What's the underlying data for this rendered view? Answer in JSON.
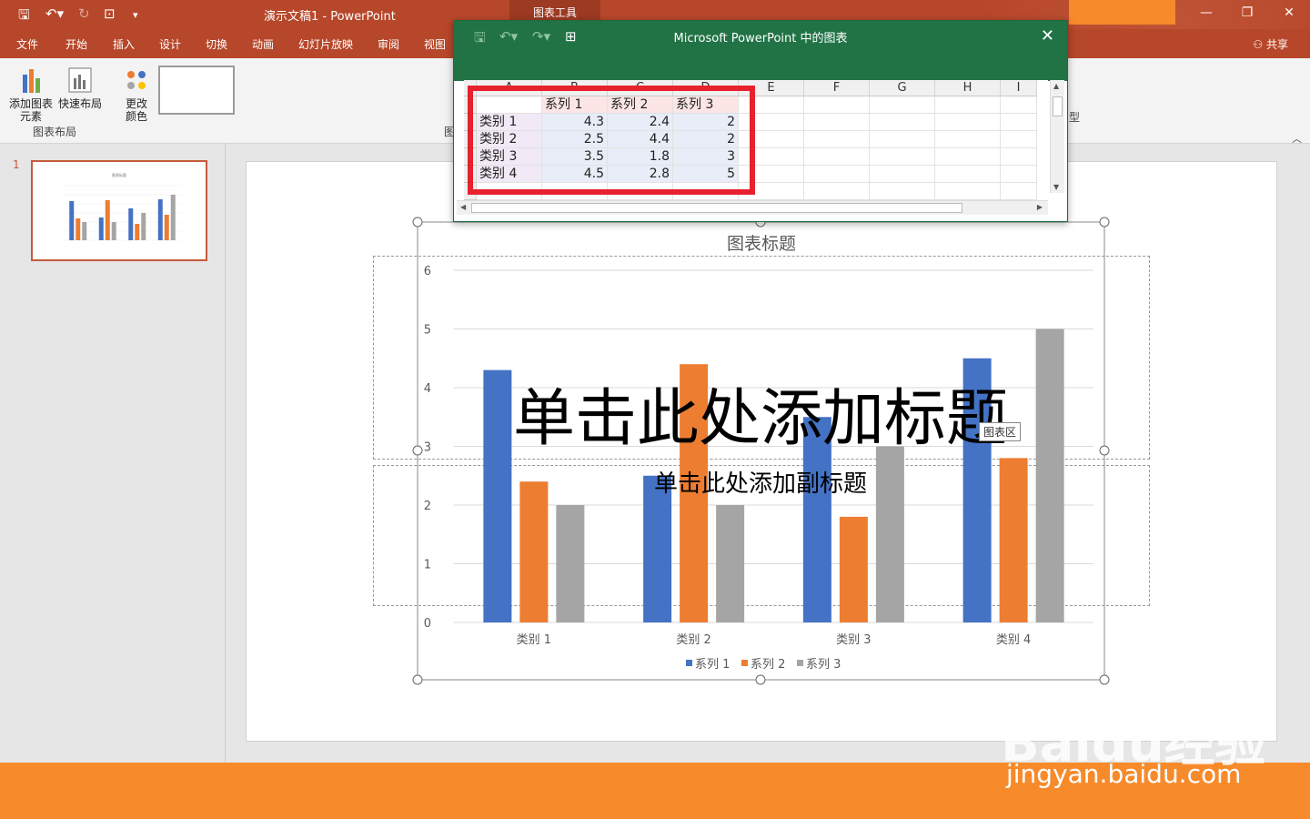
{
  "app": {
    "title": "演示文稿1  -  PowerPoint",
    "context_tab": "图表工具",
    "share": "共享"
  },
  "tabs": [
    "文件",
    "开始",
    "插入",
    "设计",
    "切换",
    "动画",
    "幻灯片放映",
    "审阅",
    "视图"
  ],
  "ribbon": {
    "add_element": "添加图表\n元素",
    "quick_layout": "快速布局",
    "change_color": "更改\n颜色",
    "group_layout": "图表布局",
    "group_styles": "图",
    "type_label": "型"
  },
  "slide_panel": {
    "slide_number": "1"
  },
  "excel": {
    "title": "Microsoft PowerPoint 中的图表",
    "columns": [
      "A",
      "B",
      "C",
      "D",
      "E",
      "F",
      "G",
      "H",
      "I"
    ],
    "header_row": [
      "",
      "系列 1",
      "系列 2",
      "系列 3"
    ],
    "rows": [
      [
        "类别 1",
        "4.3",
        "2.4",
        "2"
      ],
      [
        "类别 2",
        "2.5",
        "4.4",
        "2"
      ],
      [
        "类别 3",
        "3.5",
        "1.8",
        "3"
      ],
      [
        "类别 4",
        "4.5",
        "2.8",
        "5"
      ]
    ]
  },
  "slide": {
    "title_placeholder": "单击此处添加标题",
    "subtitle_placeholder": "单击此处添加副标题",
    "tooltip": "图表区"
  },
  "colors": {
    "accent": "#b7472a",
    "series1": "#4472c4",
    "series2": "#ed7d31",
    "series3": "#a5a5a5"
  },
  "chart_data": {
    "type": "bar",
    "title": "图表标题",
    "categories": [
      "类别 1",
      "类别 2",
      "类别 3",
      "类别 4"
    ],
    "series": [
      {
        "name": "系列 1",
        "values": [
          4.3,
          2.5,
          3.5,
          4.5
        ]
      },
      {
        "name": "系列 2",
        "values": [
          2.4,
          4.4,
          1.8,
          2.8
        ]
      },
      {
        "name": "系列 3",
        "values": [
          2,
          2,
          3,
          5
        ]
      }
    ],
    "ylim": [
      0,
      6
    ],
    "yticks": [
      0,
      1,
      2,
      3,
      4,
      5,
      6
    ],
    "grid": true,
    "legend": "bottom"
  },
  "watermark": {
    "brand": "Baidu经验",
    "url": "jingyan.baidu.com"
  }
}
